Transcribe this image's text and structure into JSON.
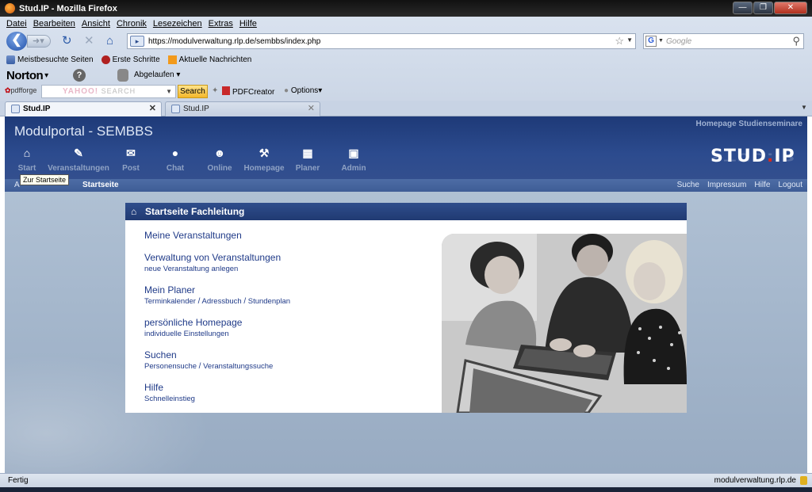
{
  "window": {
    "title": "Stud.IP - Mozilla Firefox"
  },
  "menu": [
    "Datei",
    "Bearbeiten",
    "Ansicht",
    "Chronik",
    "Lesezeichen",
    "Extras",
    "Hilfe"
  ],
  "url": "https://modulverwaltung.rlp.de/sembbs/index.php",
  "search_placeholder": "Google",
  "bookmarks": [
    "Meistbesuchte Seiten",
    "Erste Schritte",
    "Aktuelle Nachrichten"
  ],
  "norton": {
    "brand": "Norton",
    "status": "Abgelaufen"
  },
  "toolbar2": {
    "pdfforge": "pdfforge",
    "yahoo_brand": "YAHOO!",
    "yahoo_search_word": "SEARCH",
    "search_button": "Search",
    "pdfcreator": "PDFCreator",
    "options": "Options"
  },
  "tabs": [
    {
      "label": "Stud.IP",
      "active": true
    },
    {
      "label": "Stud.IP",
      "active": false
    }
  ],
  "site": {
    "portal_title": "Modulportal - SEMBBS",
    "homepage_link": "Homepage Studienseminare",
    "logo_text": "STUD",
    "logo_dot": ".",
    "logo_suffix": "IP",
    "nav": [
      {
        "label": "Start",
        "icon": "house-icon"
      },
      {
        "label": "Veranstaltungen",
        "icon": "courses-icon"
      },
      {
        "label": "Post",
        "icon": "mail-icon"
      },
      {
        "label": "Chat",
        "icon": "chat-icon"
      },
      {
        "label": "Online",
        "icon": "online-icon"
      },
      {
        "label": "Homepage",
        "icon": "tools-icon"
      },
      {
        "label": "Planer",
        "icon": "calendar-icon"
      },
      {
        "label": "Admin",
        "icon": "lock-icon"
      }
    ],
    "tooltip": "Zur Startseite",
    "breadcrumb_current": "Startseite",
    "breadcrumb_prefix": "A",
    "right_links": [
      "Suche",
      "Impressum",
      "Hilfe",
      "Logout"
    ]
  },
  "box": {
    "title": "Startseite Fachleitung",
    "groups": [
      {
        "main": "Meine Veranstaltungen",
        "subs": []
      },
      {
        "main": "Verwaltung von Veranstaltungen",
        "subs": [
          "neue Veranstaltung anlegen"
        ]
      },
      {
        "main": "Mein Planer",
        "subs": [
          "Terminkalender",
          "Adressbuch",
          "Stundenplan"
        ]
      },
      {
        "main": "persönliche Homepage",
        "subs": [
          "individuelle Einstellungen"
        ]
      },
      {
        "main": "Suchen",
        "subs": [
          "Personensuche",
          "Veranstaltungssuche"
        ]
      },
      {
        "main": "Hilfe",
        "subs": [
          "Schnelleinstieg"
        ]
      }
    ]
  },
  "status": {
    "left": "Fertig",
    "right": "modulverwaltung.rlp.de"
  }
}
